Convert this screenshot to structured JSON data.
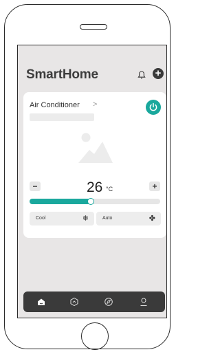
{
  "app": {
    "title": "SmartHome"
  },
  "device": {
    "name": "Air Conditioner",
    "chevron": ">"
  },
  "temperature": {
    "value": "26",
    "unit": "°C",
    "minus": "−",
    "plus": "+"
  },
  "slider": {
    "level": 0.47
  },
  "modes": [
    {
      "label": "Cool",
      "icon": "snowflake-icon",
      "glyph": "❄"
    },
    {
      "label": "Auto",
      "icon": "fan-icon",
      "glyph": "✤"
    }
  ],
  "header": {
    "add": "+"
  },
  "colors": {
    "accent": "#1aa89d",
    "tabbar": "#3a3a3a",
    "background": "#e8e6e6"
  },
  "tabs": [
    {
      "icon": "home-icon"
    },
    {
      "icon": "scenes-icon"
    },
    {
      "icon": "discover-icon"
    },
    {
      "icon": "profile-icon"
    }
  ]
}
